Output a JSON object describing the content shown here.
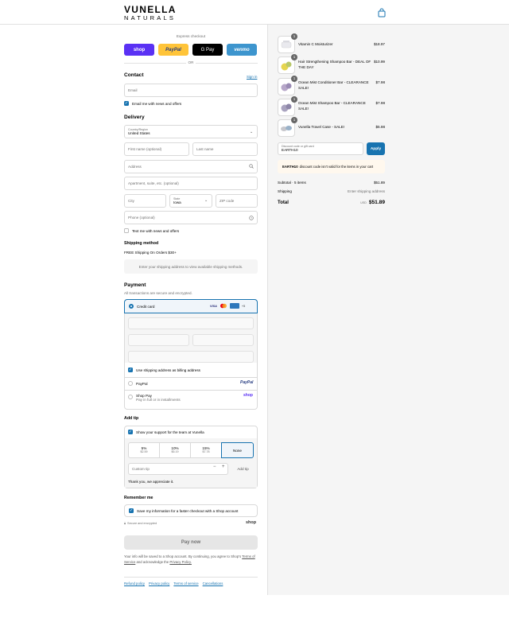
{
  "brand": {
    "name": "VUNELLA",
    "subname": "NATURALS"
  },
  "express": {
    "title": "Express checkout",
    "buttons": [
      {
        "label": "shop",
        "bg": "#5a31f4",
        "fg": "#ffffff"
      },
      {
        "label": "PayPal",
        "bg": "#ffc439",
        "fg": "#253b80"
      },
      {
        "label": "G Pay",
        "bg": "#000000",
        "fg": "#ffffff"
      },
      {
        "label": "venmo",
        "bg": "#3d95ce",
        "fg": "#ffffff"
      }
    ],
    "or": "OR"
  },
  "contact": {
    "title": "Contact",
    "signin": "Sign in",
    "email_placeholder": "Email",
    "email_news": "Email me with news and offers"
  },
  "delivery": {
    "title": "Delivery",
    "country_label": "Country/Region",
    "country_value": "United States",
    "first_name": "First name (optional)",
    "last_name": "Last name",
    "address": "Address",
    "apartment": "Apartment, suite, etc. (optional)",
    "city": "City",
    "state_label": "State",
    "state_value": "Iowa",
    "zip": "ZIP code",
    "phone": "Phone (optional)",
    "text_news": "Text me with news and offers"
  },
  "shipping": {
    "title": "Shipping method",
    "free_note": "FREE Shipping On Orders $30+",
    "placeholder": "Enter your shipping address to view available shipping methods."
  },
  "payment": {
    "title": "Payment",
    "subtitle": "All transactions are secure and encrypted.",
    "credit_card": "Credit card",
    "more_cards": "+5",
    "billing_same": "Use shipping address as billing address",
    "paypal": "PayPal",
    "shop_pay": "Shop Pay",
    "shop_pay_sub": "Pay in full or in installments"
  },
  "tip": {
    "title": "Add tip",
    "support": "Show your support for the team at Vunella",
    "options": [
      {
        "pct": "5%",
        "amt": "$2.59"
      },
      {
        "pct": "10%",
        "amt": "$5.19"
      },
      {
        "pct": "15%",
        "amt": "$7.78"
      },
      {
        "pct": "None",
        "amt": ""
      }
    ],
    "custom_placeholder": "Custom tip",
    "add_label": "Add tip",
    "thanks": "Thank you, we appreciate it."
  },
  "remember": {
    "title": "Remember me",
    "save_info": "Save my information for a faster checkout with a Shop account",
    "secure": "Secure and encrypted",
    "shop_logo": "shop"
  },
  "pay_now": "Pay now",
  "legal": {
    "line1": "Your info will be saved to a Shop account. By continuing, you agree to Shop's",
    "tos": "Terms of Service",
    "mid": "and acknowledge the",
    "privacy": "Privacy Policy."
  },
  "footer": [
    "Refund policy",
    "Privacy policy",
    "Terms of service",
    "Cancellations"
  ],
  "cart": {
    "items": [
      {
        "qty": "1",
        "name": "Vitamin C Moisturizer",
        "price": "$18.97"
      },
      {
        "qty": "1",
        "name": "Hair Strengthening Shampoo Bar - DEAL OF THE DAY",
        "price": "$10.99"
      },
      {
        "qty": "1",
        "name": "Ocean Mist Conditioner Bar - CLEARANCE SALE!",
        "price": "$7.98"
      },
      {
        "qty": "1",
        "name": "Ocean Mist Shampoo Bar - CLEARANCE SALE!",
        "price": "$7.98"
      },
      {
        "qty": "1",
        "name": "Vunella Travel Case - SALE!",
        "price": "$5.98"
      }
    ],
    "discount_label": "Discount code or gift card",
    "discount_value": "EARTH10",
    "apply": "Apply",
    "error_code": "EARTH10",
    "error_text": "discount code isn't valid for the items in your cart",
    "subtotal_label": "Subtotal · 5 items",
    "subtotal_value": "$51.89",
    "shipping_label": "Shipping",
    "shipping_value": "Enter shipping address",
    "total_label": "Total",
    "currency": "USD",
    "total_value": "$51.89"
  },
  "colors": {
    "accent": "#1773b0",
    "apply_bg": "#1773b0",
    "error_bg": "#fff8ee",
    "panel_bg": "#f5f5f5"
  }
}
